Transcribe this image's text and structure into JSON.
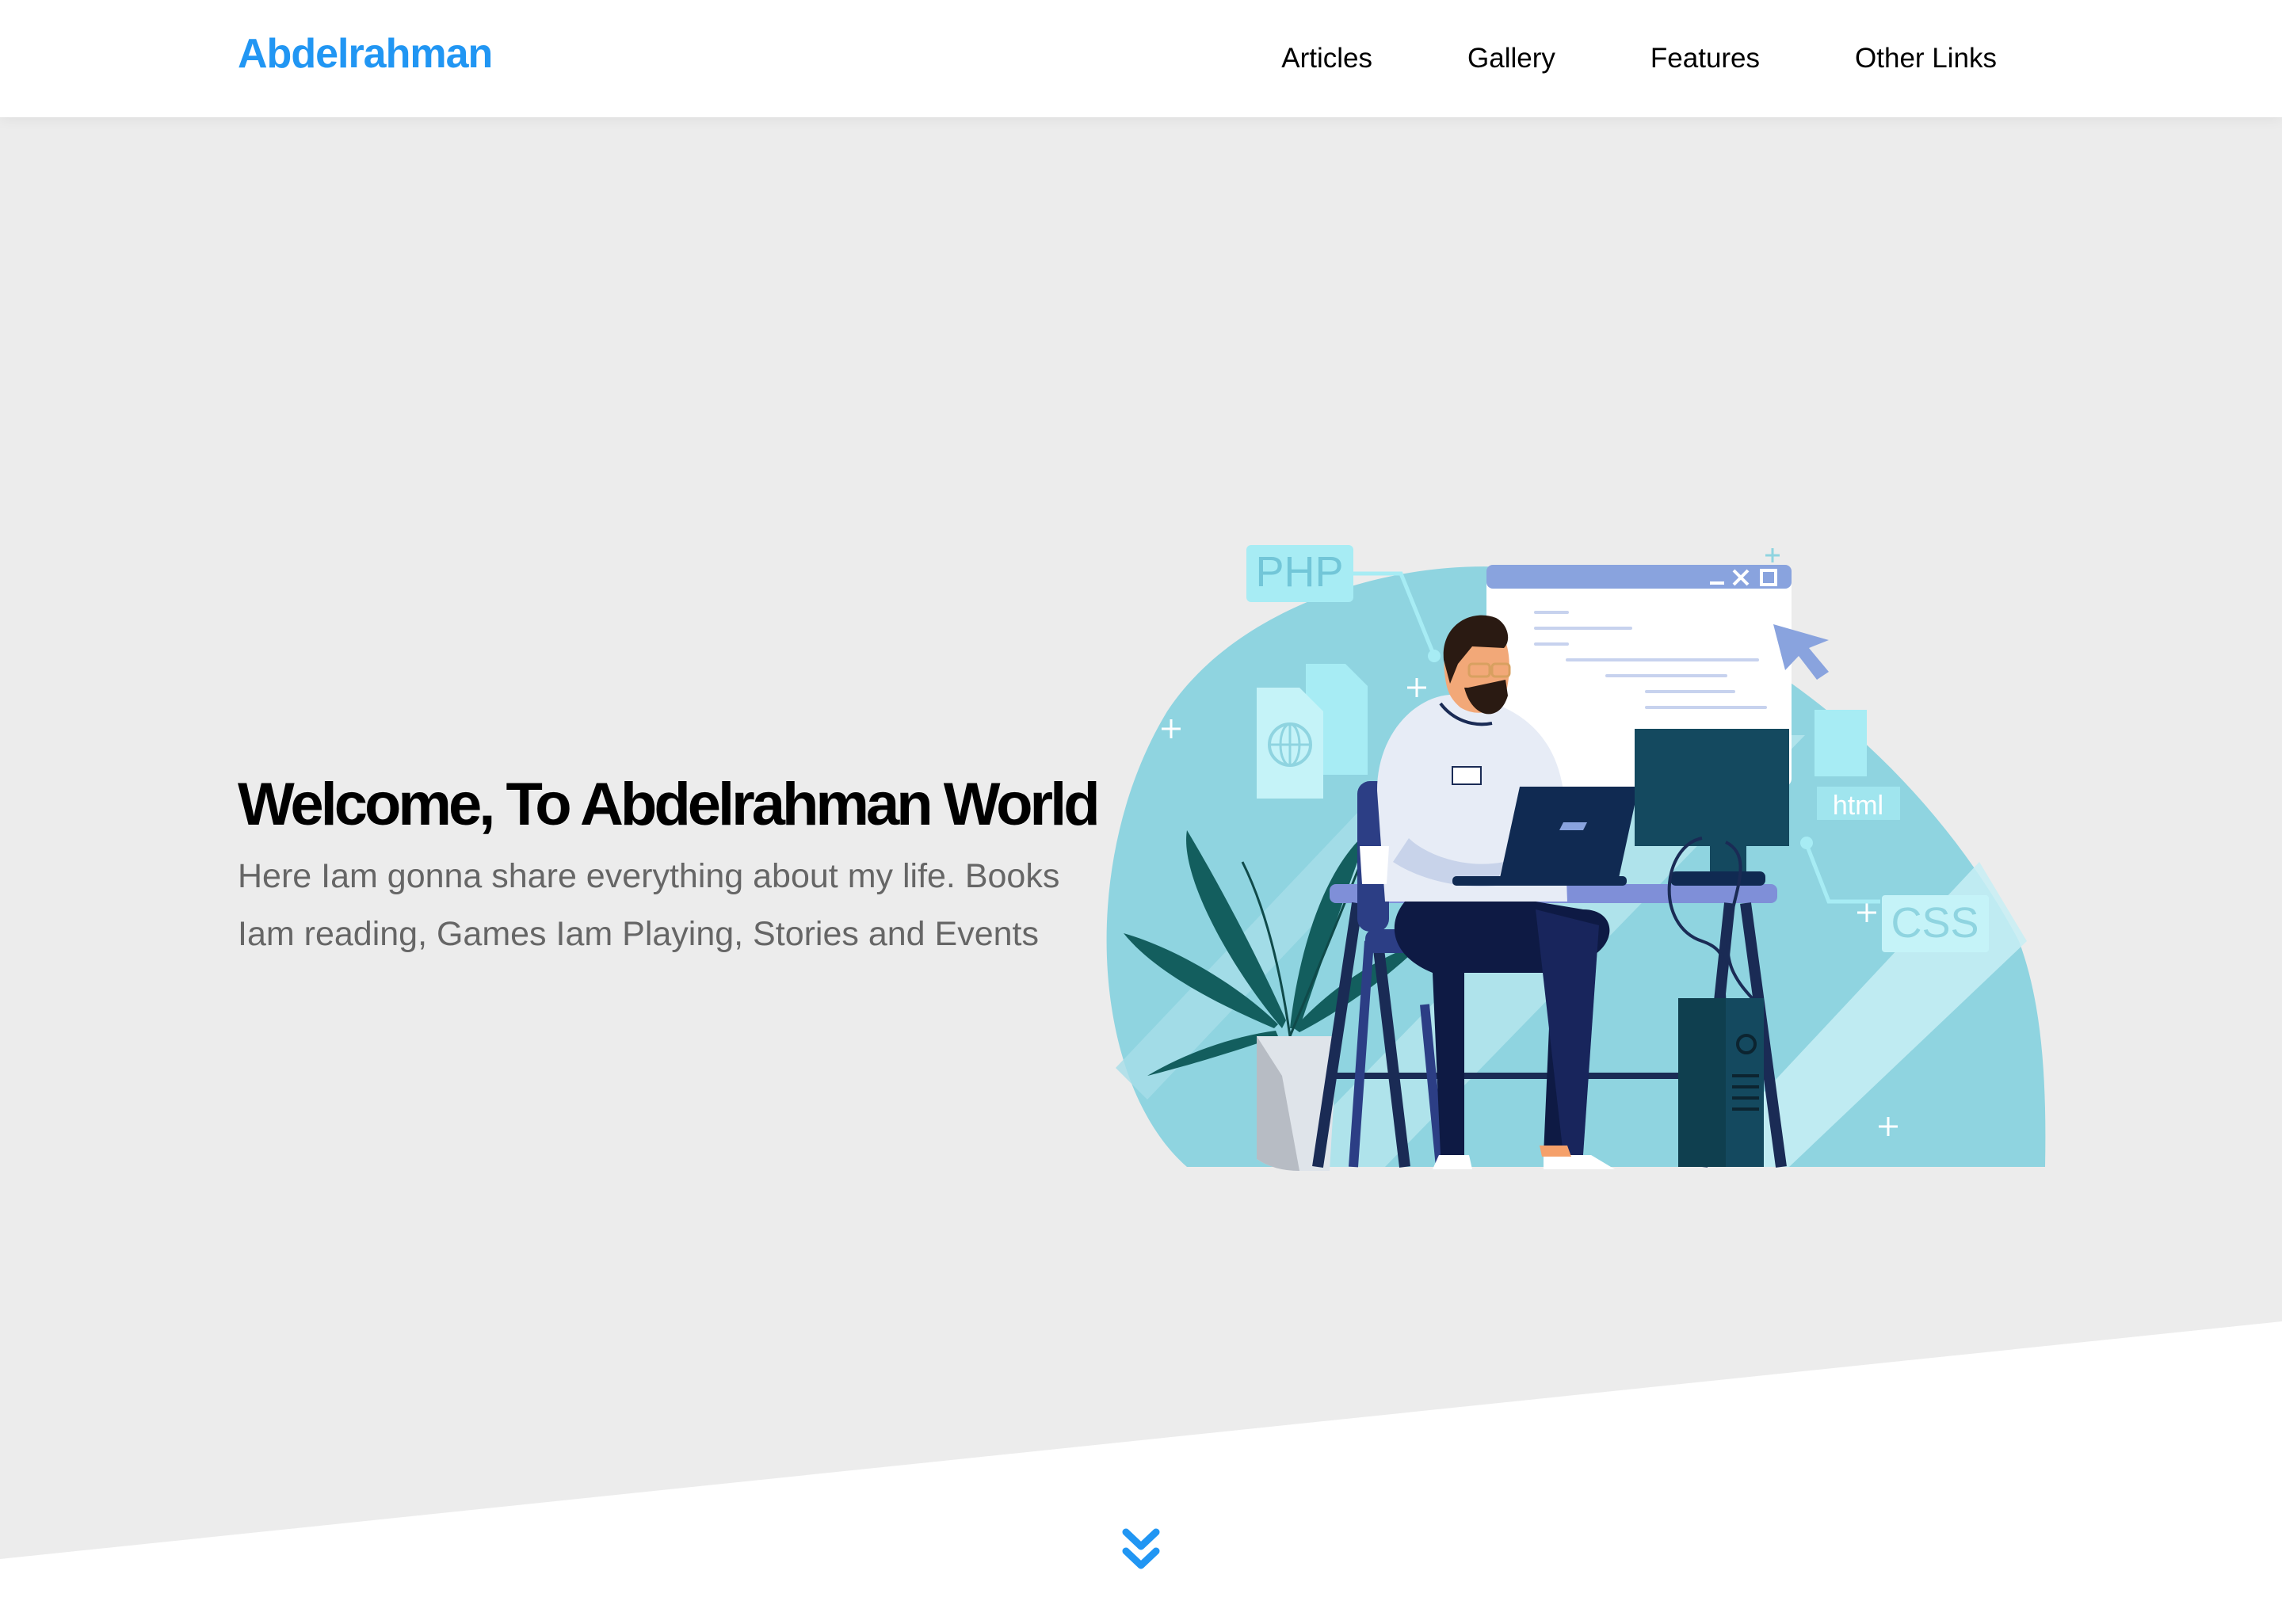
{
  "header": {
    "logo": "Abdelrahman",
    "nav": [
      {
        "label": "Articles"
      },
      {
        "label": "Gallery"
      },
      {
        "label": "Features"
      },
      {
        "label": "Other Links"
      }
    ]
  },
  "hero": {
    "title": "Welcome, To Abdelrahman World",
    "description": "Here Iam gonna share everything about my life. Books Iam reading, Games Iam Playing, Stories and Events",
    "illustration_labels": {
      "php": "PHP",
      "html": "html",
      "css": "CSS"
    }
  },
  "scroll": {
    "icon": "double-chevron-down-icon"
  },
  "colors": {
    "brand": "#2196f3",
    "hero_background": "#ececec",
    "illustration_blob": "#8fd4e0",
    "illustration_navy": "#1a2b55"
  }
}
